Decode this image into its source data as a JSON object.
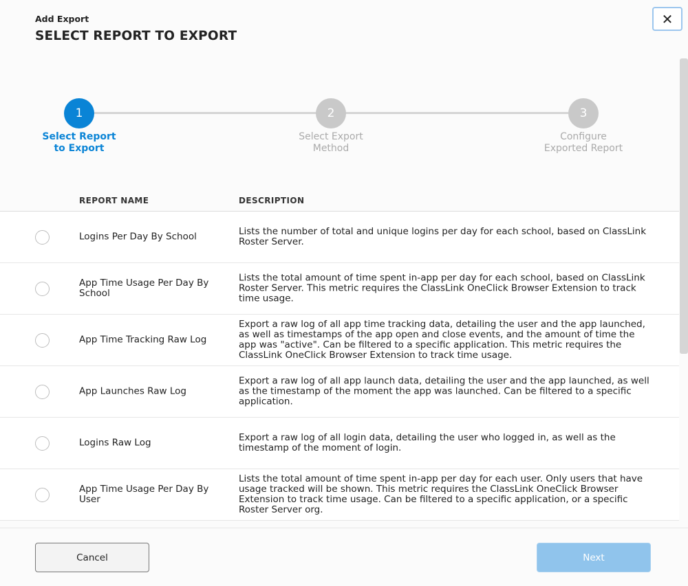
{
  "header": {
    "subtitle": "Add Export",
    "title": "SELECT REPORT TO EXPORT",
    "close_icon": "close-icon",
    "close_glyph": "✕"
  },
  "steps": [
    {
      "number": "1",
      "label": "Select Report to Export",
      "active": true
    },
    {
      "number": "2",
      "label": "Select Export Method",
      "active": false
    },
    {
      "number": "3",
      "label": "Configure Exported Report",
      "active": false
    }
  ],
  "table": {
    "columns": [
      "REPORT NAME",
      "DESCRIPTION"
    ],
    "rows": [
      {
        "name": "Logins Per Day By School",
        "description": "Lists the number of total and unique logins per day for each school, based on ClassLink Roster Server."
      },
      {
        "name": "App Time Usage Per Day By School",
        "description": "Lists the total amount of time spent in-app per day for each school, based on ClassLink Roster Server. This metric requires the ClassLink OneClick Browser Extension to track time usage."
      },
      {
        "name": "App Time Tracking Raw Log",
        "description": "Export a raw log of all app time tracking data, detailing the user and the app launched, as well as timestamps of the app open and close events, and the amount of time the app was \"active\". Can be filtered to a specific application. This metric requires the ClassLink OneClick Browser Extension to track time usage."
      },
      {
        "name": "App Launches Raw Log",
        "description": "Export a raw log of all app launch data, detailing the user and the app launched, as well as the timestamp of the moment the app was launched. Can be filtered to a specific application."
      },
      {
        "name": "Logins Raw Log",
        "description": "Export a raw log of all login data, detailing the user who logged in, as well as the timestamp of the moment of login."
      },
      {
        "name": "App Time Usage Per Day By User",
        "description": "Lists the total amount of time spent in-app per day for each user. Only users that have usage tracked will be shown. This metric requires the ClassLink OneClick Browser Extension to track time usage. Can be filtered to a specific application, or a specific Roster Server org."
      }
    ]
  },
  "footer": {
    "cancel": "Cancel",
    "next": "Next"
  },
  "colors": {
    "accent": "#0a84d6",
    "inactive": "#c9c9c9",
    "next_disabled": "#90c4ec"
  }
}
